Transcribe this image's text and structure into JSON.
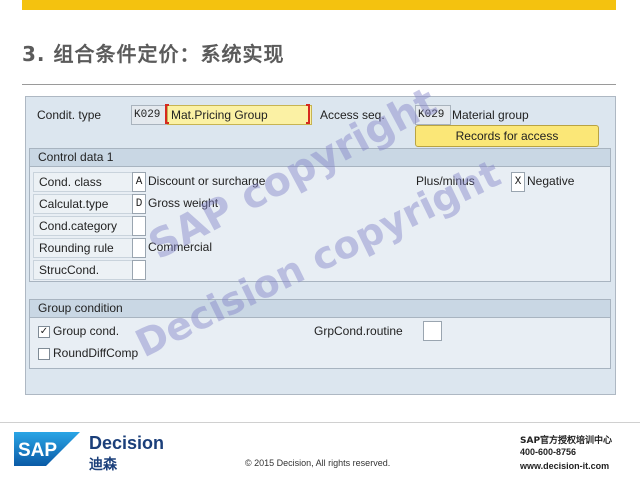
{
  "slide": {
    "title": "3. 组合条件定价：系统实现",
    "accent_color": "#f4c20f"
  },
  "sap": {
    "condit_type_label": "Condit. type",
    "condit_type_code": "K029",
    "condit_type_name": "Mat.Pricing Group",
    "access_seq_label": "Access seq.",
    "access_seq_code": "K029",
    "access_seq_name": "Material group",
    "records_button": "Records for access",
    "control_data": {
      "title": "Control data 1",
      "cond_class_label": "Cond. class",
      "cond_class_value": "A",
      "cond_class_text": "Discount or surcharge",
      "calculat_type_label": "Calculat.type",
      "calculat_type_value": "D",
      "calculat_type_text": "Gross weight",
      "cond_category_label": "Cond.category",
      "rounding_rule_label": "Rounding rule",
      "rounding_rule_text": "Commercial",
      "struc_cond_label": "StrucCond.",
      "plus_minus_label": "Plus/minus",
      "plus_minus_value": "X",
      "plus_minus_text": "Negative"
    },
    "group_condition": {
      "title": "Group condition",
      "group_cond_label": "Group cond.",
      "group_cond_checked": "✓",
      "round_diff_label": "RoundDiffComp",
      "grp_cond_routine_label": "GrpCond.routine"
    }
  },
  "watermarks": [
    "SAP copyright",
    "Decision copyright"
  ],
  "footer": {
    "brand_en": "Decision",
    "brand_cn": "迪森",
    "copyright": "© 2015 Decision, All rights reserved.",
    "contact_line1": "SAP官方授权培训中心",
    "contact_line2": "400-600-8756",
    "contact_line3": "www.decision-it.com",
    "logo_text": "SAP"
  }
}
